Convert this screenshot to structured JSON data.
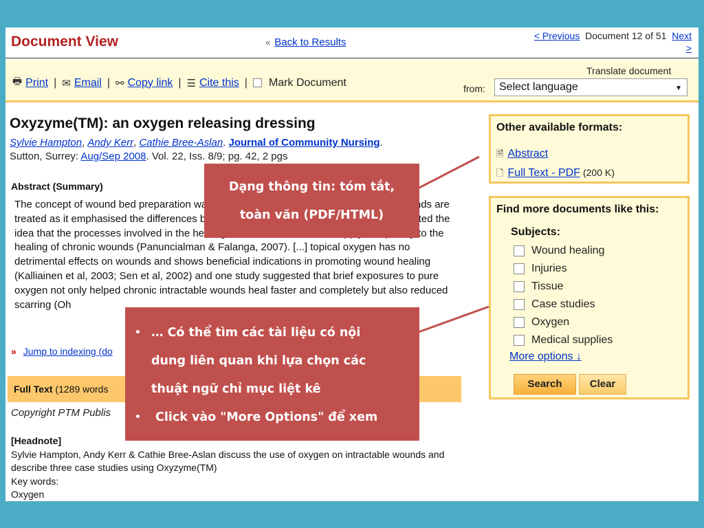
{
  "header": {
    "title": "Document View",
    "back_chevron": "«",
    "back_label": "Back to Results",
    "prev_label": "< Previous",
    "position_text": "Document 12 of 51",
    "next_label": "Next",
    "next_arrow": ">"
  },
  "toolbar": {
    "print_label": "Print",
    "email_label": "Email",
    "copy_link_label": "Copy link",
    "cite_label": "Cite this",
    "mark_label": "Mark Document",
    "translate_label": "Translate document",
    "from_label": "from:",
    "language_value": "Select language"
  },
  "article": {
    "title": "Oxyzyme(TM): an oxygen releasing dressing",
    "authors": [
      "Sylvie Hampton",
      "Andy Kerr",
      "Cathie Bree-Aslan"
    ],
    "journal": "Journal of Community Nursing",
    "location": "Sutton, Surrey:",
    "date": "Aug/Sep 2008",
    "details": ". Vol. 22, Iss. 8/9; pg. 42, 2 pgs",
    "abstract_heading": "Abstract (Summary)",
    "abstract_text": "The concept of wound bed preparation was described in relation to the way chronic wounds are treated as it emphasised the differences between acute and chronic wounds, and cemented the idea that the processes involved in the healing of acute wounds do not apply completely to the healing of chronic wounds (Panuncialman & Falanga, 2007). [...] topical oxygen has no detrimental effects on wounds and shows beneficial indications in promoting wound healing (Kalliainen et al, 2003; Sen et al, 2002) and one study suggested that brief exposures to pure oxygen not only helped chronic intractable wounds heal faster and completely but also reduced scarring (Oh",
    "jump_label": "Jump to indexing (do",
    "fulltext_label": "Full Text",
    "fulltext_count": " (1289  words",
    "copyright": "Copyright PTM Publis",
    "headnote_title": "[Headnote]",
    "headnote_text": "Sylvie Hampton, Andy Kerr & Cathie Bree-Aslan discuss the use of oxygen on intractable wounds and describe three case studies using Oxyzyme(TM)",
    "keywords_label": "Key words:",
    "keyword_1": "Oxygen"
  },
  "sidebar": {
    "formats_title": "Other available formats:",
    "abstract_link": "Abstract",
    "pdf_link": "Full Text - PDF",
    "pdf_size": "(200 K)",
    "more_title": "Find more documents like this:",
    "subjects_label": "Subjects:",
    "subjects": [
      "Wound healing",
      "Injuries",
      "Tissue",
      "Case studies",
      "Oxygen",
      "Medical supplies"
    ],
    "more_options": "More options ↓",
    "search_label": "Search",
    "clear_label": "Clear"
  },
  "callouts": {
    "c1_line1": "Dạng thông tin: tóm tắt,",
    "c1_line2": "toàn văn (PDF/HTML)",
    "c2_b1_line1": "… Có thể tìm các tài liệu có nội",
    "c2_b1_line2": "dung liên quan khi lựa chọn các",
    "c2_b1_line3": "thuật ngữ chỉ mục liệt kê",
    "c2_b2": "Click vào \"More Options\" để xem"
  },
  "colors": {
    "background": "#4bacc6",
    "title_red": "#b22222",
    "link_blue": "#0033cc",
    "toolbar_bg": "#fffbd8",
    "accent_orange": "#f7c65d",
    "callout": "#c0504d"
  }
}
